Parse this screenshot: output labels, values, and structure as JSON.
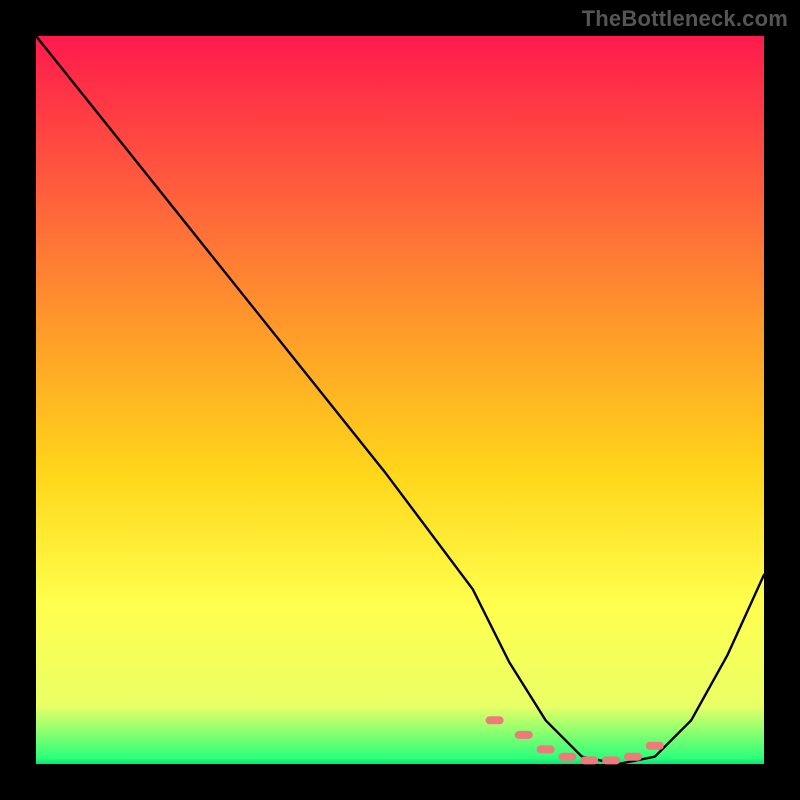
{
  "watermark": "TheBottleneck.com",
  "chart_data": {
    "type": "line",
    "title": "",
    "xlabel": "",
    "ylabel": "",
    "xlim": [
      0,
      100
    ],
    "ylim": [
      0,
      100
    ],
    "grid": false,
    "series": [
      {
        "name": "bottleneck-curve",
        "x": [
          0,
          12,
          24,
          36,
          48,
          60,
          65,
          70,
          75,
          80,
          85,
          90,
          95,
          100
        ],
        "values": [
          100,
          85,
          70,
          55,
          40,
          24,
          14,
          6,
          1,
          0,
          1,
          6,
          15,
          26
        ]
      }
    ],
    "markers": {
      "name": "highlight-band",
      "x": [
        63,
        67,
        70,
        73,
        76,
        79,
        82,
        85
      ],
      "values": [
        6,
        4,
        2,
        1,
        0.5,
        0.5,
        1,
        2.5
      ],
      "color": "#ef7a7a"
    },
    "gradient_stops": [
      {
        "t": 0.0,
        "color": "#ff1a4d"
      },
      {
        "t": 0.25,
        "color": "#ff6a3a"
      },
      {
        "t": 0.6,
        "color": "#ffd61a"
      },
      {
        "t": 0.92,
        "color": "#eaff66"
      },
      {
        "t": 1.0,
        "color": "#00e676"
      }
    ]
  }
}
